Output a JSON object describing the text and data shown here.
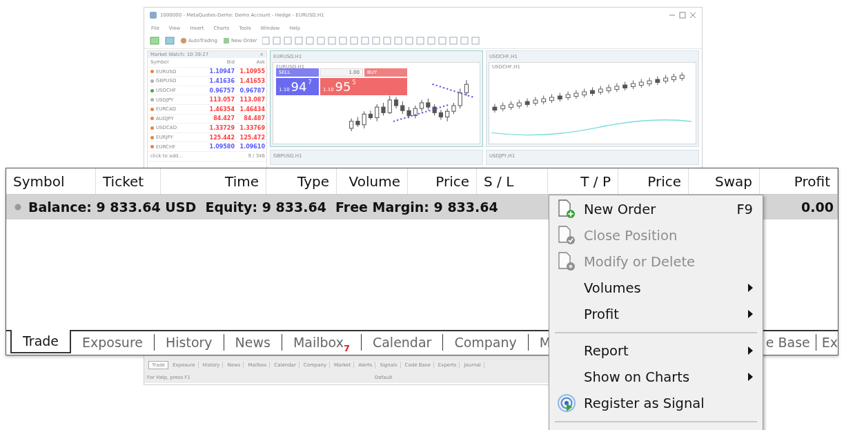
{
  "mini_window": {
    "title": "1000000 - MetaQuotes-Demo: Demo Account - Hedge - EURUSD,H1",
    "menu": [
      "File",
      "View",
      "Insert",
      "Charts",
      "Tools",
      "Window",
      "Help"
    ],
    "toolbar": {
      "autotrading": "AutoTrading",
      "new_order": "New Order"
    },
    "market_watch": {
      "title": "Market Watch: 10:39:27",
      "close": "×",
      "columns": [
        "Symbol",
        "Bid",
        "Ask"
      ],
      "rows": [
        {
          "symbol": "EURUSD",
          "color": "#f08040",
          "bid": {
            "text": "1.10947",
            "color": "#5a5aff"
          },
          "ask": {
            "text": "1.10955",
            "color": "#ff4040"
          }
        },
        {
          "symbol": "GBPUSD",
          "color": "#b0b0b0",
          "bid": {
            "text": "1.41636",
            "color": "#5a5aff"
          },
          "ask": {
            "text": "1.41653",
            "color": "#ff4040"
          }
        },
        {
          "symbol": "USDCHF",
          "color": "#40b040",
          "bid": {
            "text": "0.96757",
            "color": "#5a5aff"
          },
          "ask": {
            "text": "0.96787",
            "color": "#5a5aff"
          }
        },
        {
          "symbol": "USDJPY",
          "color": "#b0b0b0",
          "bid": {
            "text": "113.057",
            "color": "#ff4040"
          },
          "ask": {
            "text": "113.087",
            "color": "#ff4040"
          }
        },
        {
          "symbol": "EURCAD",
          "color": "#f08040",
          "bid": {
            "text": "1.46354",
            "color": "#ff4040"
          },
          "ask": {
            "text": "1.46434",
            "color": "#ff4040"
          }
        },
        {
          "symbol": "AUDJPY",
          "color": "#f08040",
          "bid": {
            "text": "84.427",
            "color": "#ff4040"
          },
          "ask": {
            "text": "84.487",
            "color": "#ff4040"
          }
        },
        {
          "symbol": "USDCAD",
          "color": "#f08040",
          "bid": {
            "text": "1.33729",
            "color": "#ff4040"
          },
          "ask": {
            "text": "1.33769",
            "color": "#ff4040"
          }
        },
        {
          "symbol": "EURJPY",
          "color": "#f08040",
          "bid": {
            "text": "125.442",
            "color": "#ff4040"
          },
          "ask": {
            "text": "125.472",
            "color": "#ff4040"
          }
        },
        {
          "symbol": "EURCHF",
          "color": "#f08040",
          "bid": {
            "text": "1.09580",
            "color": "#5a5aff"
          },
          "ask": {
            "text": "1.09610",
            "color": "#5a5aff"
          }
        }
      ],
      "add_row": "click to add...",
      "count": "9 / 346"
    },
    "charts": [
      {
        "title": "EURUSD,H1",
        "label": "EURUSD,H1",
        "active": true,
        "trade_panel": {
          "sell": "SELL",
          "buy": "BUY",
          "volume": "1.00",
          "sell_price": {
            "small": "1.10",
            "big": "94",
            "sup": "7"
          },
          "buy_price": {
            "small": "1.10",
            "big": "95",
            "sup": "5"
          }
        }
      },
      {
        "title": "USDCHF,H1",
        "label": "USDCHF,H1",
        "active": false
      }
    ],
    "lower_chart_titles": [
      "GBPUSD,H1",
      "USDJPY,H1"
    ],
    "tabs": [
      {
        "label": "Trade",
        "selected": true
      },
      {
        "label": "Exposure",
        "selected": false
      },
      {
        "label": "History",
        "selected": false
      },
      {
        "label": "News",
        "selected": false
      },
      {
        "label": "Mailbox",
        "selected": false
      },
      {
        "label": "Calendar",
        "selected": false
      },
      {
        "label": "Company",
        "selected": false
      },
      {
        "label": "Market",
        "selected": false
      },
      {
        "label": "Alerts",
        "selected": false
      },
      {
        "label": "Signals",
        "selected": false
      },
      {
        "label": "Code Base",
        "selected": false
      },
      {
        "label": "Experts",
        "selected": false
      },
      {
        "label": "Journal",
        "selected": false
      }
    ],
    "status": [
      "For Help, press F1",
      "Default"
    ]
  },
  "toolbox": {
    "columns": [
      "Symbol",
      "Ticket",
      "Time",
      "Type",
      "Volume",
      "Price",
      "S / L",
      "T / P",
      "Price",
      "Swap",
      "Profit"
    ],
    "balance_row": {
      "summary": "Balance: 9 833.64 USD  Equity: 9 833.64  Free Margin: 9 833.64",
      "profit": "0.00"
    },
    "tabs": [
      {
        "label": "Trade",
        "selected": true
      },
      {
        "label": "Exposure",
        "selected": false
      },
      {
        "label": "History",
        "selected": false
      },
      {
        "label": "News",
        "selected": false
      },
      {
        "label": "Mailbox",
        "selected": false,
        "badge": "7"
      },
      {
        "label": "Calendar",
        "selected": false
      },
      {
        "label": "Company",
        "selected": false
      },
      {
        "label": "M",
        "selected": false
      }
    ],
    "tabs_after_menu": [
      {
        "label": "e Base",
        "selected": false
      },
      {
        "label": "Ex",
        "selected": false
      }
    ]
  },
  "context_menu": [
    {
      "kind": "new",
      "label": "New Order",
      "shortcut": "F9",
      "disabled": false,
      "submenu": false
    },
    {
      "kind": "close",
      "label": "Close Position",
      "disabled": true,
      "submenu": false
    },
    {
      "kind": "modify",
      "label": "Modify or Delete",
      "disabled": true,
      "submenu": false
    },
    {
      "kind": "item",
      "label": "Volumes",
      "disabled": false,
      "submenu": true
    },
    {
      "kind": "item",
      "label": "Profit",
      "disabled": false,
      "submenu": true
    },
    {
      "kind": "separator"
    },
    {
      "kind": "item",
      "label": "Report",
      "disabled": false,
      "submenu": true
    },
    {
      "kind": "item",
      "label": "Show on Charts",
      "disabled": false,
      "submenu": true
    },
    {
      "kind": "signal",
      "label": "Register as Signal",
      "disabled": false,
      "submenu": false
    },
    {
      "kind": "separator"
    }
  ]
}
